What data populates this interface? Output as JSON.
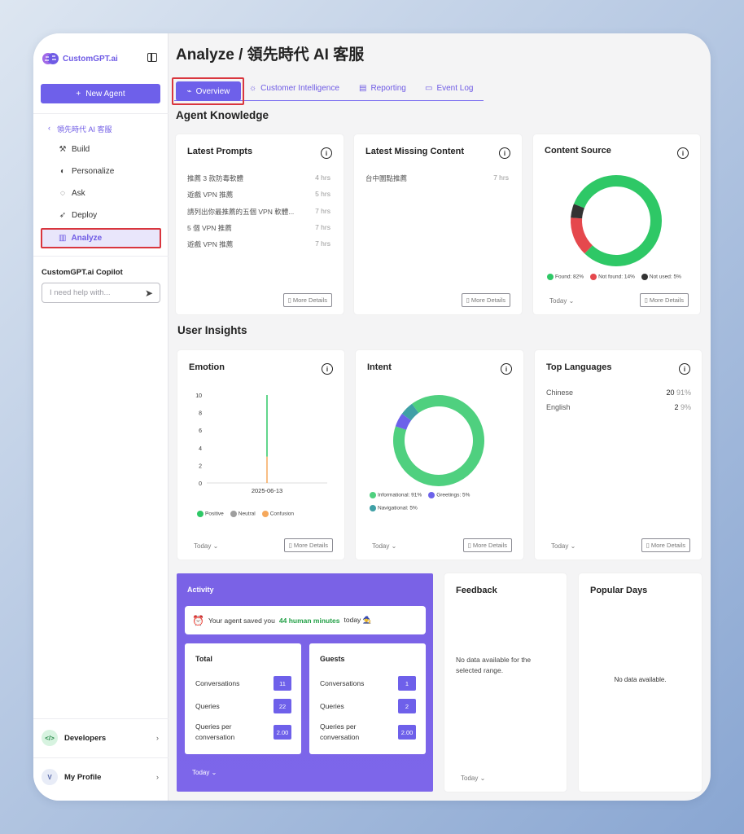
{
  "sidebar": {
    "logo_text": "CustomGPT.ai",
    "new_agent_label": "New Agent",
    "agent_back_label": "領先時代 AI 客服",
    "nav": {
      "build": "Build",
      "personalize": "Personalize",
      "ask": "Ask",
      "deploy": "Deploy",
      "analyze": "Analyze"
    },
    "copilot_title": "CustomGPT.ai Copilot",
    "copilot_placeholder": "I need help with...",
    "developers_label": "Developers",
    "developers_badge": "</>",
    "profile_label": "My Profile",
    "profile_initial": "V"
  },
  "header": {
    "title": "Analyze / 領先時代 AI 客服"
  },
  "tabs": {
    "overview": "Overview",
    "customer_intelligence": "Customer Intelligence",
    "reporting": "Reporting",
    "event_log": "Event Log"
  },
  "sections": {
    "agent_knowledge": "Agent Knowledge",
    "user_insights": "User Insights"
  },
  "common": {
    "more_details": "More Details",
    "today": "Today"
  },
  "latest_prompts": {
    "title": "Latest Prompts",
    "items": [
      {
        "text": "推薦 3 款防毒軟體",
        "time": "4 hrs"
      },
      {
        "text": "遊戲 VPN 推薦",
        "time": "5 hrs"
      },
      {
        "text": "請列出你最推薦的五個 VPN 軟體...",
        "time": "7 hrs"
      },
      {
        "text": "5 個 VPN 推薦",
        "time": "7 hrs"
      },
      {
        "text": "遊戲 VPN 推薦",
        "time": "7 hrs"
      }
    ]
  },
  "missing_content": {
    "title": "Latest Missing Content",
    "items": [
      {
        "text": "台中圜點推薦",
        "time": "7 hrs"
      }
    ]
  },
  "content_source": {
    "title": "Content Source",
    "legend": [
      {
        "label": "Found: 82%",
        "value": 82,
        "color": "#2ec866"
      },
      {
        "label": "Not found: 14%",
        "value": 14,
        "color": "#e5484d"
      },
      {
        "label": "Not used: 5%",
        "value": 5,
        "color": "#333333"
      }
    ]
  },
  "emotion": {
    "title": "Emotion",
    "y_ticks": [
      "10",
      "8",
      "6",
      "4",
      "2",
      "0"
    ],
    "x_label": "2025-06-13",
    "legend": [
      {
        "label": "Positive",
        "color": "#2ec866"
      },
      {
        "label": "Neutral",
        "color": "#9e9e9e"
      },
      {
        "label": "Confusion",
        "color": "#f5a85c"
      }
    ]
  },
  "intent": {
    "title": "Intent",
    "legend": [
      {
        "label": "Informational: 91%",
        "value": 91,
        "color": "#4fd07f"
      },
      {
        "label": "Greetings: 5%",
        "value": 5,
        "color": "#6c62ea"
      },
      {
        "label": "Navigational: 5%",
        "value": 5,
        "color": "#3fa0a6"
      }
    ]
  },
  "top_languages": {
    "title": "Top Languages",
    "items": [
      {
        "name": "Chinese",
        "count": "20",
        "pct": "91%"
      },
      {
        "name": "English",
        "count": "2",
        "pct": "9%"
      }
    ]
  },
  "activity": {
    "title": "Activity",
    "saved_prefix": "Your agent saved you",
    "saved_highlight": "44 human minutes",
    "saved_suffix": "today 🧙",
    "total": {
      "title": "Total",
      "conversations_label": "Conversations",
      "conversations": "11",
      "queries_label": "Queries",
      "queries": "22",
      "qpc_label_1": "Queries per",
      "qpc_label_2": "conversation",
      "qpc": "2.00"
    },
    "guests": {
      "title": "Guests",
      "conversations_label": "Conversations",
      "conversations": "1",
      "queries_label": "Queries",
      "queries": "2",
      "qpc_label_1": "Queries per",
      "qpc_label_2": "conversation",
      "qpc": "2.00"
    }
  },
  "feedback": {
    "title": "Feedback",
    "empty": "No data available for the selected range."
  },
  "popular_days": {
    "title": "Popular Days",
    "empty": "No data available."
  }
}
